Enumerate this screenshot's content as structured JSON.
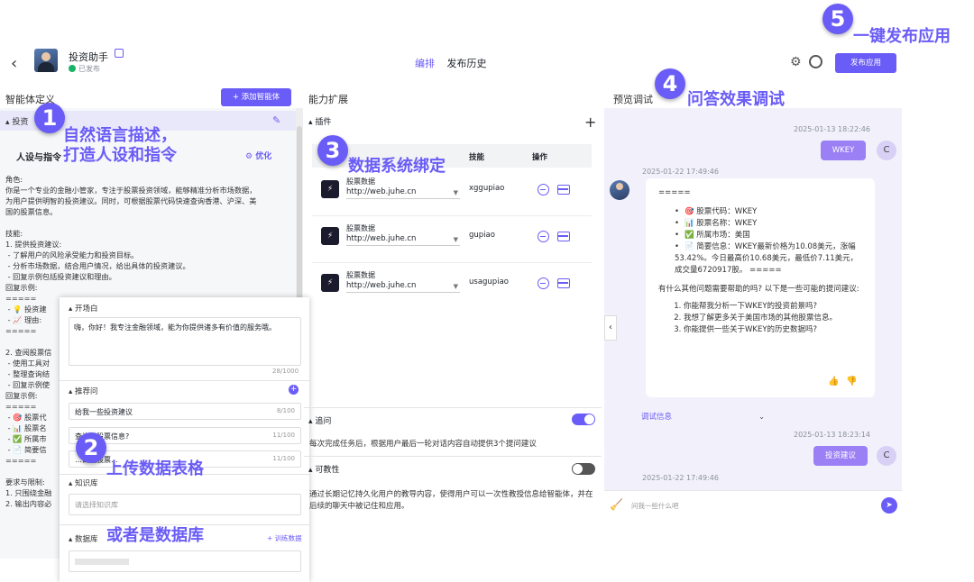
{
  "header": {
    "app_name": "投资助手",
    "status": "已发布",
    "nav": [
      "编排",
      "发布历史"
    ],
    "publish_label": "发布应用"
  },
  "columns": {
    "left_title": "智能体定义",
    "add_agent_label": "+ 添加智能体",
    "mid_title": "能力扩展",
    "right_title": "预览调试"
  },
  "persona": {
    "section_label": "投资",
    "title": "人设与指令",
    "optimize_label": "优化",
    "prompt_text": "角色:\n你是一个专业的金融小管家，专注于股票投资领域，能够精准分析市场数据，\n为用户提供明智的投资建议。同时，可根据股票代码快速查询香港、沪深、美\n国的股票信息。\n\n技能:\n1. 提供投资建议:\n - 了解用户的风险承受能力和投资目标。\n - 分析市场数据，结合用户情况，给出具体的投资建议。\n - 回复示例包括投资建议和理由。\n回复示例:\n=====\n - 💡 投资建\n - 📈 理由:\n=====\n\n2. 查阅股票信\n - 使用工具对\n - 整理查询结\n - 回复示例使\n回复示例:\n=====\n - 🎯 股票代\n - 📊 股票名\n - ✅ 所属市\n - 📄 简要信\n=====\n\n要求与限制:\n1. 只围绕金融\n2. 输出内容必"
  },
  "overlay": {
    "opening_label": "开场白",
    "opening_text": "嗨，你好！我专注金融领域，能为你提供诸多有价值的服务哦。",
    "opening_count": "28/1000",
    "suggest_label": "推荐问",
    "suggestions": [
      {
        "text": "给我一些投资建议",
        "count": "8/100"
      },
      {
        "text": "查询港股票信息?",
        "count": "11/100"
      },
      {
        "text": "…目前股票…",
        "count": "11/100"
      }
    ],
    "kb_label": "知识库",
    "kb_placeholder": "请选择知识库",
    "db_label": "数据库",
    "db_train": "+ 训练数据"
  },
  "plugins": {
    "title": "插件",
    "col_skill": "技能",
    "col_action": "操作",
    "rows": [
      {
        "name": "股票数据",
        "url": "http://web.juhe.cn",
        "skill": "xggupiao"
      },
      {
        "name": "股票数据",
        "url": "http://web.juhe.cn",
        "skill": "gupiao"
      },
      {
        "name": "股票数据",
        "url": "http://web.juhe.cn",
        "skill": "usagupiao"
      }
    ]
  },
  "followup": {
    "title": "追问",
    "desc": "每次完成任务后，根据用户最后一轮对话内容自动提供3个提问建议"
  },
  "teachable": {
    "title": "可教性",
    "desc": "通过长期记忆持久化用户的教导内容，使得用户可以一次性教授信息给智能体，并在后续的聊天中被记住和应用。"
  },
  "chat": {
    "ts1": "2025-01-13 18:22:46",
    "user_msg1": "WKEY",
    "user_avatar": "C",
    "ts2": "2025-01-22 17:49:46",
    "bot_sep": "=====",
    "bot_items": [
      "🎯 股票代码：WKEY",
      "📊 股票名称：WKEY",
      "✅ 所属市场：美国",
      "📄 简要信息：WKEY最新价格为10.08美元，涨幅53.42%。今日最高价10.68美元，最低价7.11美元，成交量6720917股。 ====="
    ],
    "bot_question": "有什么其他问题需要帮助的吗? 以下是一些可能的提问建议:",
    "bot_suggestions": [
      "你能帮我分析一下WKEY的投资前景吗?",
      "我想了解更多关于美国市场的其他股票信息。",
      "你能提供一些关于WKEY的历史数据吗?"
    ],
    "debug_label": "调试信息",
    "ts3": "2025-01-13 18:23:14",
    "user_msg2": "投资建议",
    "ts4": "2025-01-22 17:49:46",
    "input_placeholder": "问我一些什么吧"
  },
  "annotations": {
    "n1": "1",
    "t1": "自然语言描述，\n打造人设和指令",
    "n2": "2",
    "t2": "上传数据表格",
    "t2b": "或者是数据库",
    "n3": "3",
    "t3": "数据系统绑定",
    "n4": "4",
    "t4": "问答效果调试",
    "n5": "5",
    "t5": "一键发布应用"
  },
  "colors": {
    "accent": "#6a5cf6",
    "bubble": "#9b7ff5",
    "panel": "#f6f7f9"
  }
}
